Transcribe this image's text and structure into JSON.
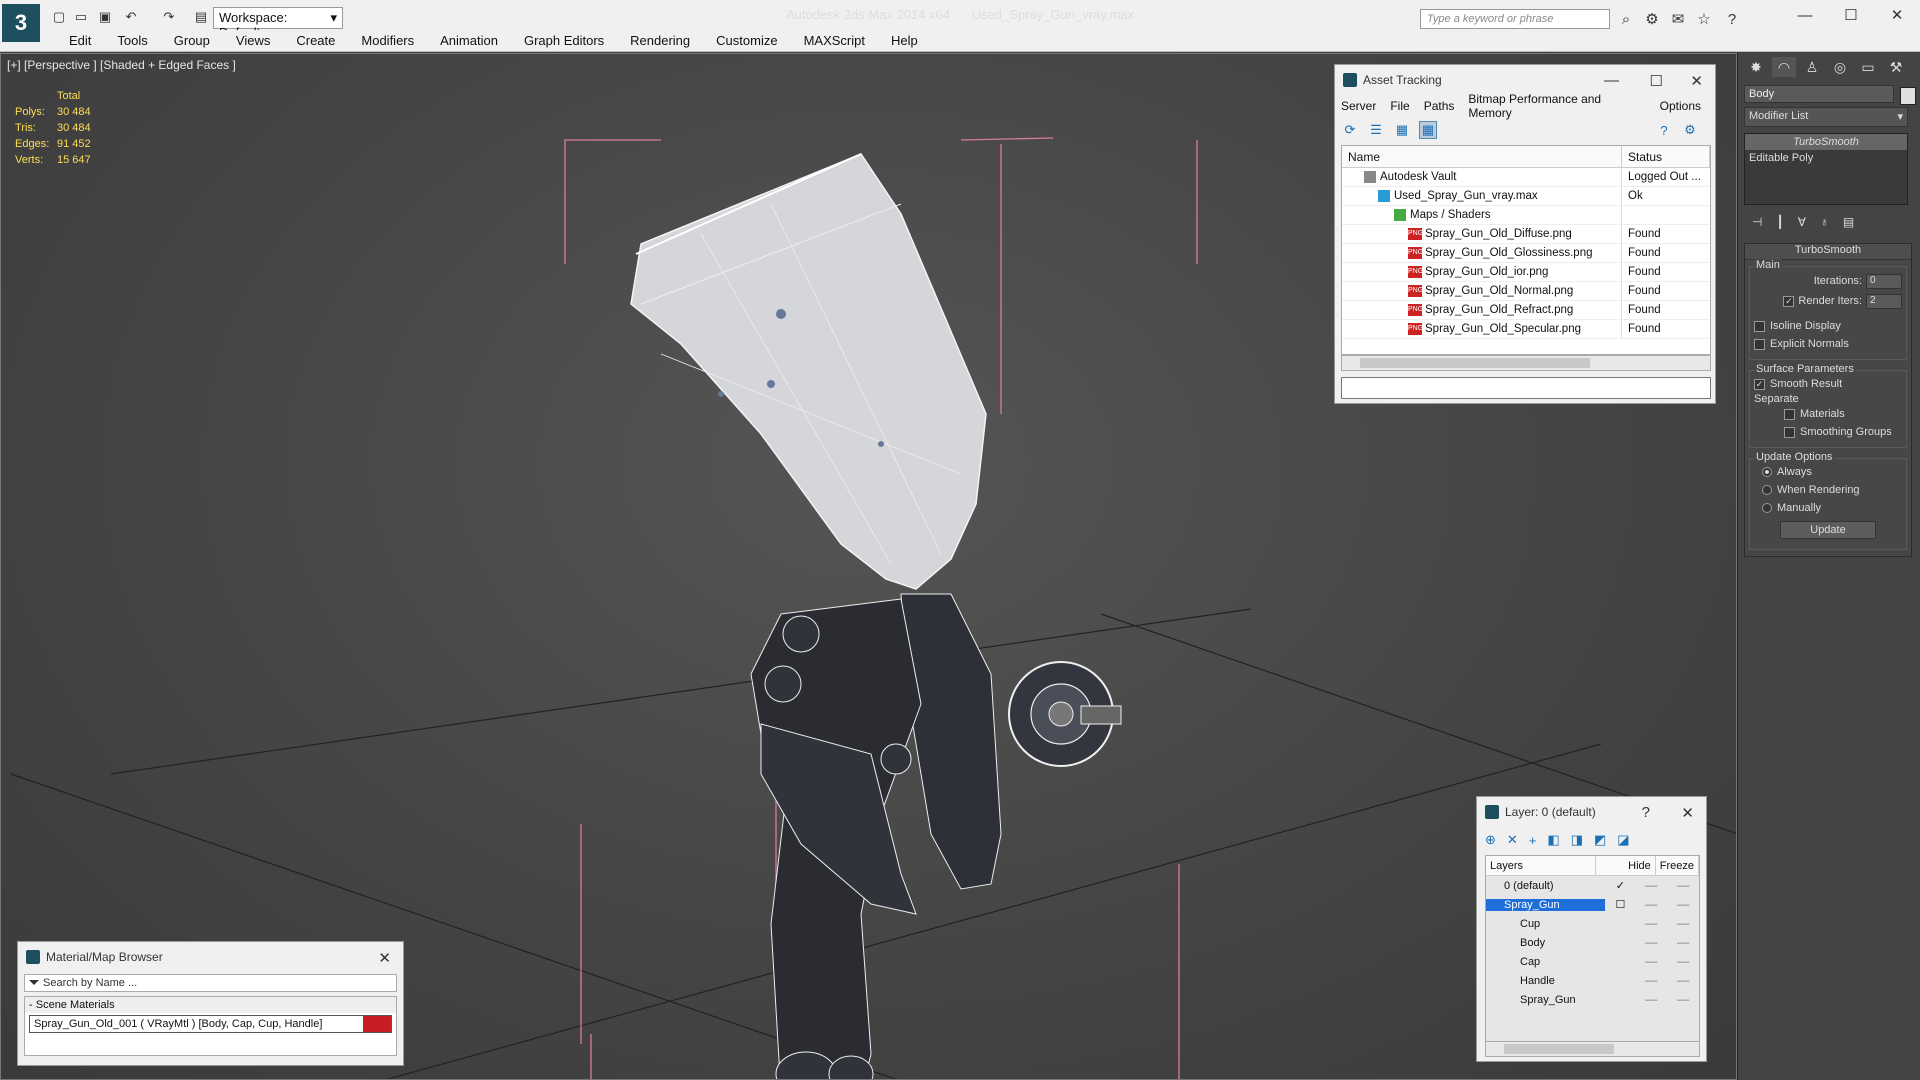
{
  "window": {
    "app_title": "Autodesk 3ds Max  2014 x64",
    "file_title": "Used_Spray_Gun_vray.max",
    "workspace_label": "Workspace: Default",
    "search_placeholder": "Type a keyword or phrase"
  },
  "menu": [
    "Edit",
    "Tools",
    "Group",
    "Views",
    "Create",
    "Modifiers",
    "Animation",
    "Graph Editors",
    "Rendering",
    "Customize",
    "MAXScript",
    "Help"
  ],
  "viewport": {
    "label": "[+] [Perspective ] [Shaded + Edged Faces ]",
    "stats": {
      "header": "Total",
      "rows": [
        {
          "key": "Polys:",
          "value": "30 484"
        },
        {
          "key": "Tris:",
          "value": "30 484"
        },
        {
          "key": "Edges:",
          "value": "91 452"
        },
        {
          "key": "Verts:",
          "value": "15 647"
        }
      ]
    }
  },
  "asset_tracking": {
    "title": "Asset Tracking",
    "menu": [
      "Server",
      "File",
      "Paths",
      "Bitmap Performance and Memory",
      "Options"
    ],
    "columns": {
      "name": "Name",
      "status": "Status"
    },
    "rows": [
      {
        "name": "Autodesk Vault",
        "status": "Logged Out ..."
      },
      {
        "name": "Used_Spray_Gun_vray.max",
        "status": "Ok"
      },
      {
        "name": "Maps / Shaders",
        "status": ""
      },
      {
        "name": "Spray_Gun_Old_Diffuse.png",
        "status": "Found"
      },
      {
        "name": "Spray_Gun_Old_Glossiness.png",
        "status": "Found"
      },
      {
        "name": "Spray_Gun_Old_ior.png",
        "status": "Found"
      },
      {
        "name": "Spray_Gun_Old_Normal.png",
        "status": "Found"
      },
      {
        "name": "Spray_Gun_Old_Refract.png",
        "status": "Found"
      },
      {
        "name": "Spray_Gun_Old_Specular.png",
        "status": "Found"
      }
    ]
  },
  "command_panel": {
    "object_name": "Body",
    "modifier_list": "Modifier List",
    "stack": [
      "TurboSmooth",
      "Editable Poly"
    ],
    "turbosmooth": {
      "title": "TurboSmooth",
      "main_label": "Main",
      "iterations_label": "Iterations:",
      "iterations_value": "0",
      "render_iters_label": "Render Iters:",
      "render_iters_value": "2",
      "isoline_label": "Isoline Display",
      "explicit_label": "Explicit Normals",
      "surface_label": "Surface Parameters",
      "smooth_result_label": "Smooth Result",
      "separate_label": "Separate",
      "materials_label": "Materials",
      "smoothing_groups_label": "Smoothing Groups",
      "update_options_label": "Update Options",
      "always_label": "Always",
      "when_rendering_label": "When Rendering",
      "manually_label": "Manually",
      "update_button": "Update"
    }
  },
  "material_browser": {
    "title": "Material/Map Browser",
    "search_placeholder": "Search by Name ...",
    "section": "Scene Materials",
    "item": "Spray_Gun_Old_001  ( VRayMtl )  [Body, Cap, Cup, Handle]",
    "swatch_color": "#c81d25"
  },
  "layers_panel": {
    "title": "Layer: 0 (default)",
    "columns": {
      "layers": "Layers",
      "hide": "Hide",
      "freeze": "Freeze"
    },
    "rows": [
      "0 (default)",
      "Spray_Gun",
      "Cup",
      "Body",
      "Cap",
      "Handle",
      "Spray_Gun"
    ]
  }
}
